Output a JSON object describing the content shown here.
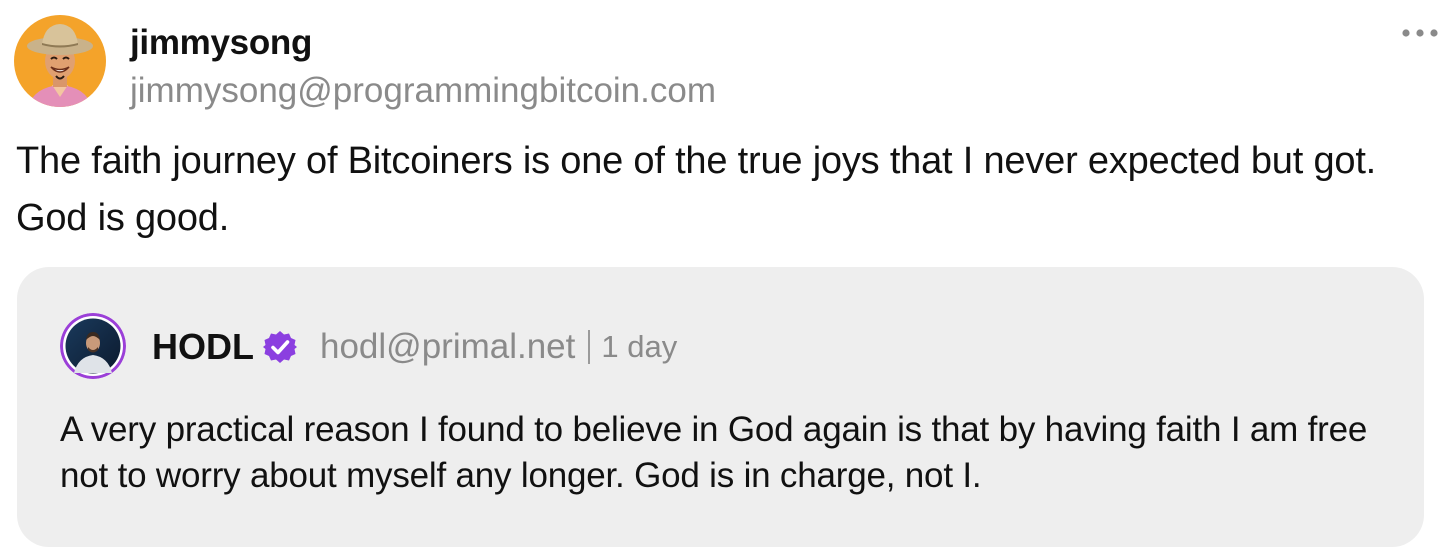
{
  "post": {
    "author_name": "jimmysong",
    "author_handle": "jimmysong@programmingbitcoin.com",
    "text": "The faith journey of Bitcoiners is one of the true joys that I never expected but got. God is good.",
    "more_icon": "more-horizontal-icon",
    "avatar_bg_color": "#f4a32a"
  },
  "quote": {
    "author_name": "HODL",
    "verified_icon": "verified-badge-icon",
    "verified_color": "#8b3fe0",
    "author_handle": "hodl@primal.net",
    "time": "1 day",
    "text": "A very practical reason I found to believe in God again is that by having faith I am free not to worry about myself any longer. God is in charge, not I.",
    "avatar_ring_color": "#9b3fd8",
    "card_bg_color": "#eeeeee"
  }
}
